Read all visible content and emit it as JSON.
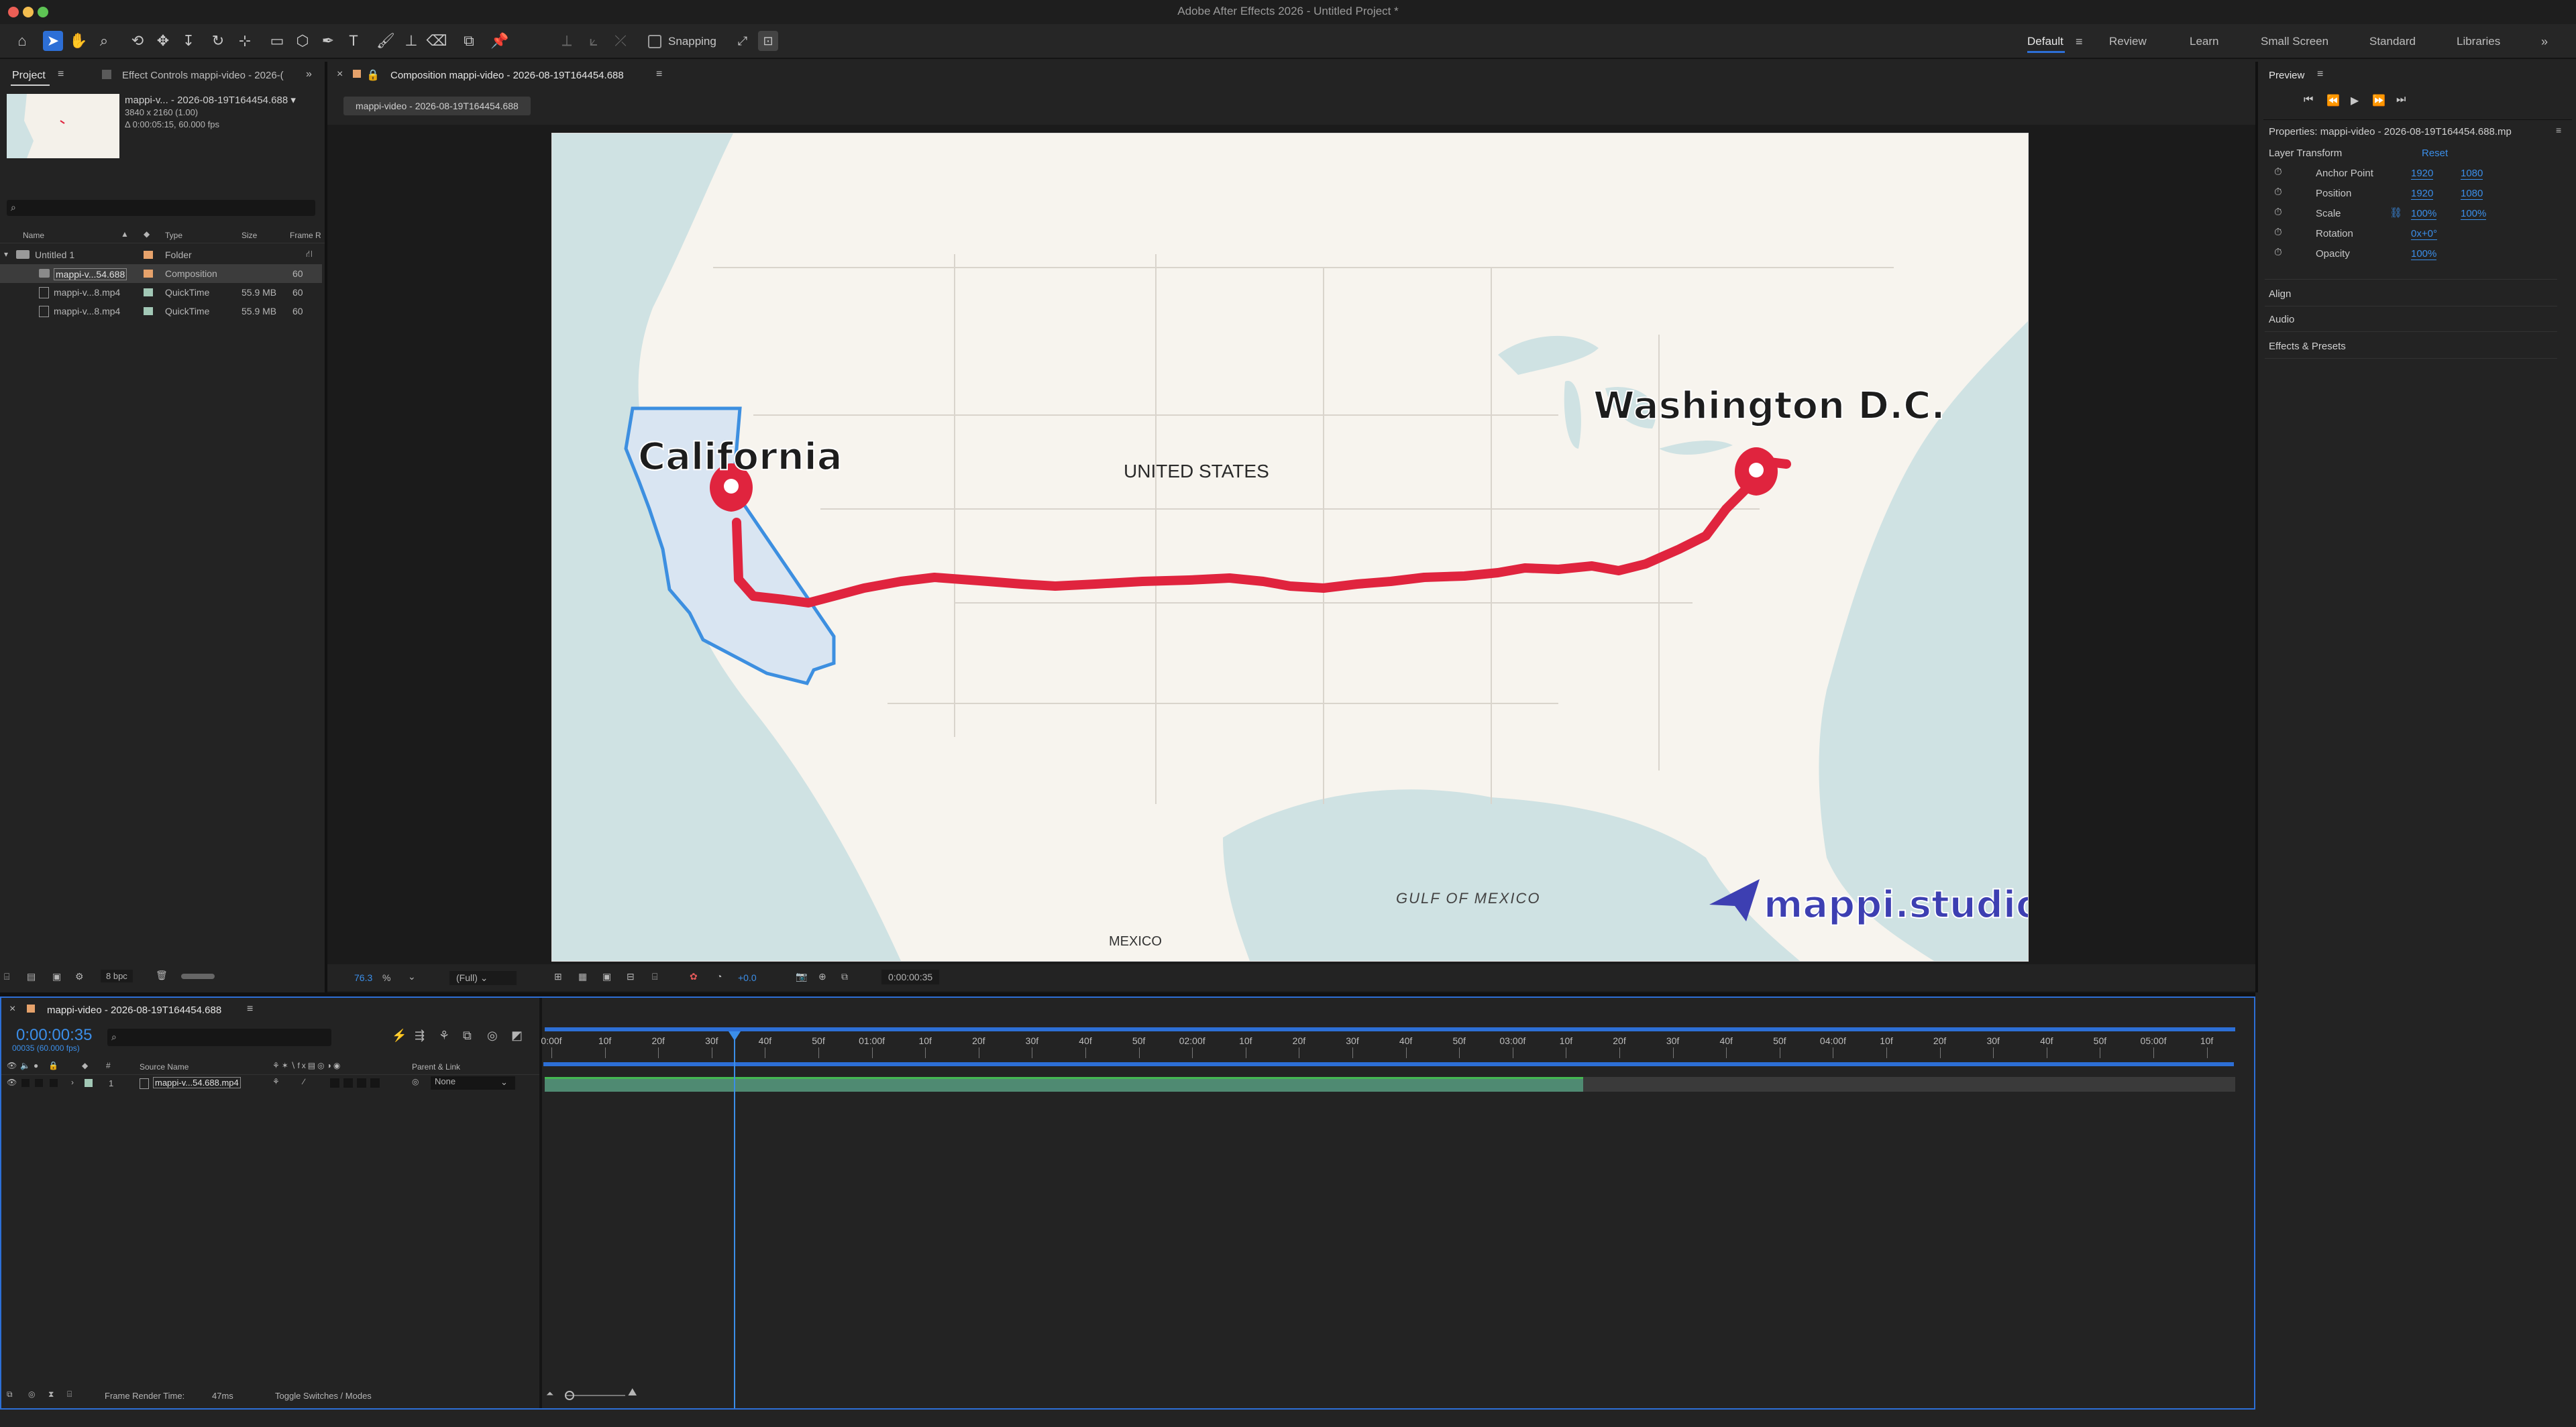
{
  "app": {
    "title": "Adobe After Effects 2026 - Untitled Project *"
  },
  "toolbar": {
    "snapping_label": "Snapping",
    "workspaces": [
      "Default",
      "Review",
      "Learn",
      "Small Screen",
      "Standard",
      "Libraries"
    ],
    "active_workspace": "Default"
  },
  "project_panel": {
    "tab_project": "Project",
    "tab_effect_controls": "Effect Controls mappi-video - 2026-(",
    "thumb_name": "mappi-v... - 2026-08-19T164454.688 ▾",
    "thumb_dims": "3840 x 2160 (1.00)",
    "thumb_duration": "Δ 0:00:05:15, 60.000 fps",
    "search_placeholder": "",
    "columns": [
      "Name",
      "Type",
      "Size",
      "Frame R"
    ],
    "items": [
      {
        "name": "Untitled 1",
        "type": "Folder",
        "size": "",
        "frame": ""
      },
      {
        "name": "mappi-v...54.688",
        "type": "Composition",
        "size": "",
        "frame": "60"
      },
      {
        "name": "mappi-v...8.mp4",
        "type": "QuickTime",
        "size": "55.9 MB",
        "frame": "60"
      },
      {
        "name": "mappi-v...8.mp4",
        "type": "QuickTime",
        "size": "55.9 MB",
        "frame": "60"
      }
    ],
    "bpc": "8 bpc"
  },
  "composition": {
    "tab_label": "Composition mappi-video - 2026-08-19T164454.688",
    "subtab_label": "mappi-video - 2026-08-19T164454.688",
    "zoom": "76.3",
    "zoom_unit": "%",
    "resolution": "(Full)",
    "exposure": "+0.0",
    "timecode": "0:00:00:35"
  },
  "map": {
    "label_california": "California",
    "label_washington": "Washington D.C.",
    "label_us": "UNITED STATES",
    "label_gulf": "GULF OF MEXICO",
    "label_mexico": "MEXICO",
    "brand": "mappi.studio",
    "route_color": "#e0243e",
    "highlight_color": "#3d8fe0"
  },
  "right_panel": {
    "preview_tab": "Preview",
    "properties_title": "Properties: mappi-video - 2026-08-19T164454.688.mp",
    "layer_transform": "Layer Transform",
    "reset": "Reset",
    "props": [
      {
        "name": "Anchor Point",
        "v1": "1920",
        "v2": "1080"
      },
      {
        "name": "Position",
        "v1": "1920",
        "v2": "1080"
      },
      {
        "name": "Scale",
        "v1": "100%",
        "v2": "100%"
      },
      {
        "name": "Rotation",
        "v1": "0x+0°",
        "v2": ""
      },
      {
        "name": "Opacity",
        "v1": "100%",
        "v2": ""
      }
    ],
    "sections": [
      "Align",
      "Audio",
      "Effects & Presets"
    ]
  },
  "timeline": {
    "tab_label": "mappi-video - 2026-08-19T164454.688",
    "timecode": "0:00:00:35",
    "timecode_sub": "00035 (60.000 fps)",
    "col_source_name": "Source Name",
    "col_parent": "Parent & Link",
    "layer_index": "1",
    "layer_name": "mappi-v...54.688.mp4",
    "parent_value": "None",
    "ruler": [
      "0:00f",
      "10f",
      "20f",
      "30f",
      "40f",
      "50f",
      "01:00f",
      "10f",
      "20f",
      "30f",
      "40f",
      "50f",
      "02:00f",
      "10f",
      "20f",
      "30f",
      "40f",
      "50f",
      "03:00f",
      "10f",
      "20f",
      "30f",
      "40f",
      "50f",
      "04:00f",
      "10f",
      "20f",
      "30f",
      "40f",
      "50f",
      "05:00f",
      "10f"
    ],
    "render_time_label": "Frame Render Time:",
    "render_time_value": "47ms",
    "toggle_label": "Toggle Switches / Modes"
  }
}
